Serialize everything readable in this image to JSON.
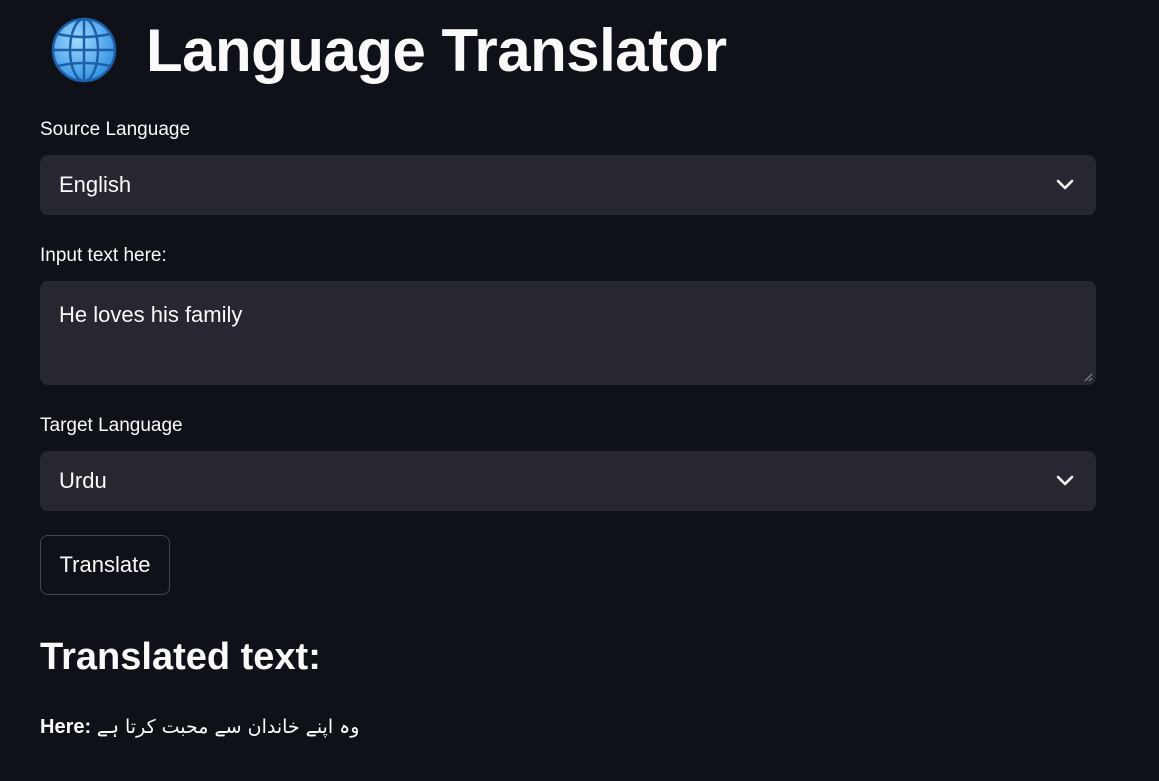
{
  "header": {
    "icon": "globe-icon",
    "title": "Language Translator"
  },
  "source": {
    "label": "Source Language",
    "selected": "English"
  },
  "input": {
    "label": "Input text here:",
    "value": "He loves his family"
  },
  "target": {
    "label": "Target Language",
    "selected": "Urdu"
  },
  "actions": {
    "translate_label": "Translate"
  },
  "output": {
    "heading": "Translated text:",
    "prefix": "Here:",
    "translation": "وہ اپنے خاندان سے محبت کرتا ہے"
  },
  "colors": {
    "background": "#0e1117",
    "widget": "#262730",
    "text": "#fafafa"
  }
}
